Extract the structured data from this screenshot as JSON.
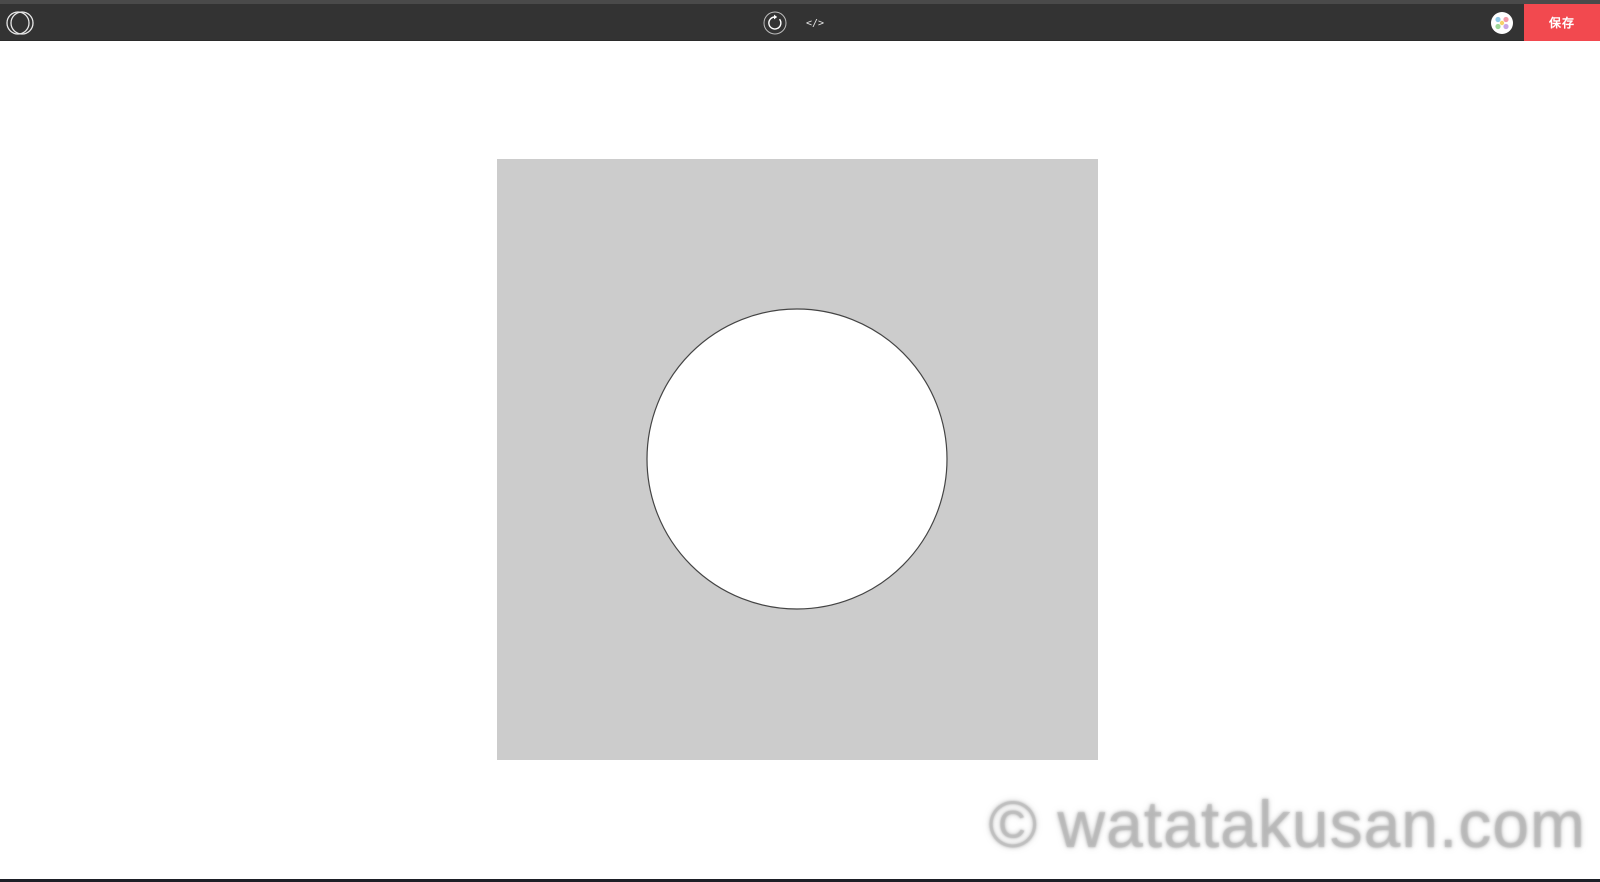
{
  "toolbar": {
    "logo_icon": "p5-logo-icon",
    "reload_icon": "reload-icon",
    "code_icon": "code-icon",
    "code_glyph": "</>",
    "palette_icon": "palette-icon",
    "save_label": "保存"
  },
  "canvas": {
    "background": "#cccccc",
    "circle_fill": "#ffffff",
    "circle_stroke": "#444444"
  },
  "watermark": {
    "text": "© watatakusan.com"
  },
  "colors": {
    "toolbar_bg": "#333333",
    "accent": "#f2494f"
  }
}
